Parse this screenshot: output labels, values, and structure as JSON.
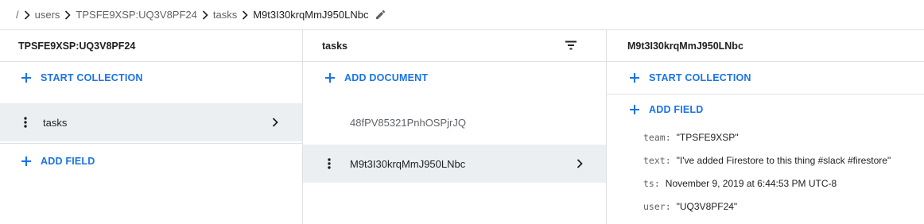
{
  "breadcrumb": {
    "root": "/",
    "items": [
      "users",
      "TPSFE9XSP:UQ3V8PF24",
      "tasks"
    ],
    "current": "M9t3I30krqMmJ950LNbc"
  },
  "col1": {
    "title": "TPSFE9XSP:UQ3V8PF24",
    "start_collection": "START COLLECTION",
    "collections": [
      "tasks"
    ],
    "add_field": "ADD FIELD"
  },
  "col2": {
    "title": "tasks",
    "add_document": "ADD DOCUMENT",
    "documents": [
      "48fPV85321PnhOSPjrJQ",
      "M9t3I30krqMmJ950LNbc"
    ]
  },
  "col3": {
    "title": "M9t3I30krqMmJ950LNbc",
    "start_collection": "START COLLECTION",
    "add_field": "ADD FIELD",
    "fields": [
      {
        "key": "team:",
        "value": "\"TPSFE9XSP\""
      },
      {
        "key": "text:",
        "value": "\"I've added Firestore to this thing #slack #firestore\""
      },
      {
        "key": "ts:",
        "value": "November 9, 2019 at 6:44:53 PM UTC-8"
      },
      {
        "key": "user:",
        "value": "\"UQ3V8PF24\""
      }
    ]
  },
  "colors": {
    "accent": "#1a73e8",
    "selected_row": "#eceff1",
    "divider": "#e0e0e0"
  }
}
